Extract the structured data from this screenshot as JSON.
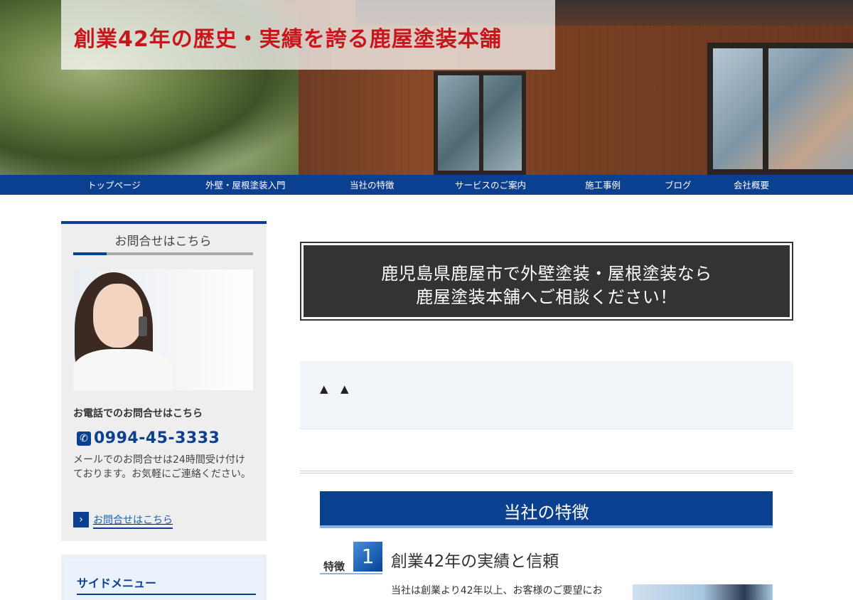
{
  "hero": {
    "caption": "創業42年の歴史・実績を誇る鹿屋塗装本舗"
  },
  "nav": {
    "items": [
      {
        "label": "トップページ"
      },
      {
        "label": "外壁・屋根塗装入門"
      },
      {
        "label": "当社の特徴"
      },
      {
        "label": "サービスのご案内"
      },
      {
        "label": "施工事例"
      },
      {
        "label": "ブログ"
      },
      {
        "label": "会社概要"
      }
    ]
  },
  "sidebar": {
    "contact_title": "お問合せはこちら",
    "tel_heading": "お電話でのお問合せはこちら",
    "tel_number": "0994-45-3333",
    "mail_text": "メールでのお問合せは24時間受け付けております。お気軽にご連絡ください。",
    "contact_link": "お問合せはこちら",
    "menu_title": "サイドメニュー"
  },
  "main": {
    "headline_line1": "鹿児島県鹿屋市で外壁塗装・屋根塗装なら",
    "headline_line2": "鹿屋塗装本舗へご相談ください！",
    "notice_marks": [
      "▲",
      "▲"
    ],
    "section_title": "当社の特徴",
    "feature": {
      "label": "特徴",
      "number": "1",
      "title": "創業42年の実績と信頼",
      "text": "当社は創業より42年以上、お客様のご要望にお"
    }
  },
  "colors": {
    "brand_blue": "#0b3f8f",
    "accent_red": "#c8161d",
    "headline_bg": "#333333"
  }
}
